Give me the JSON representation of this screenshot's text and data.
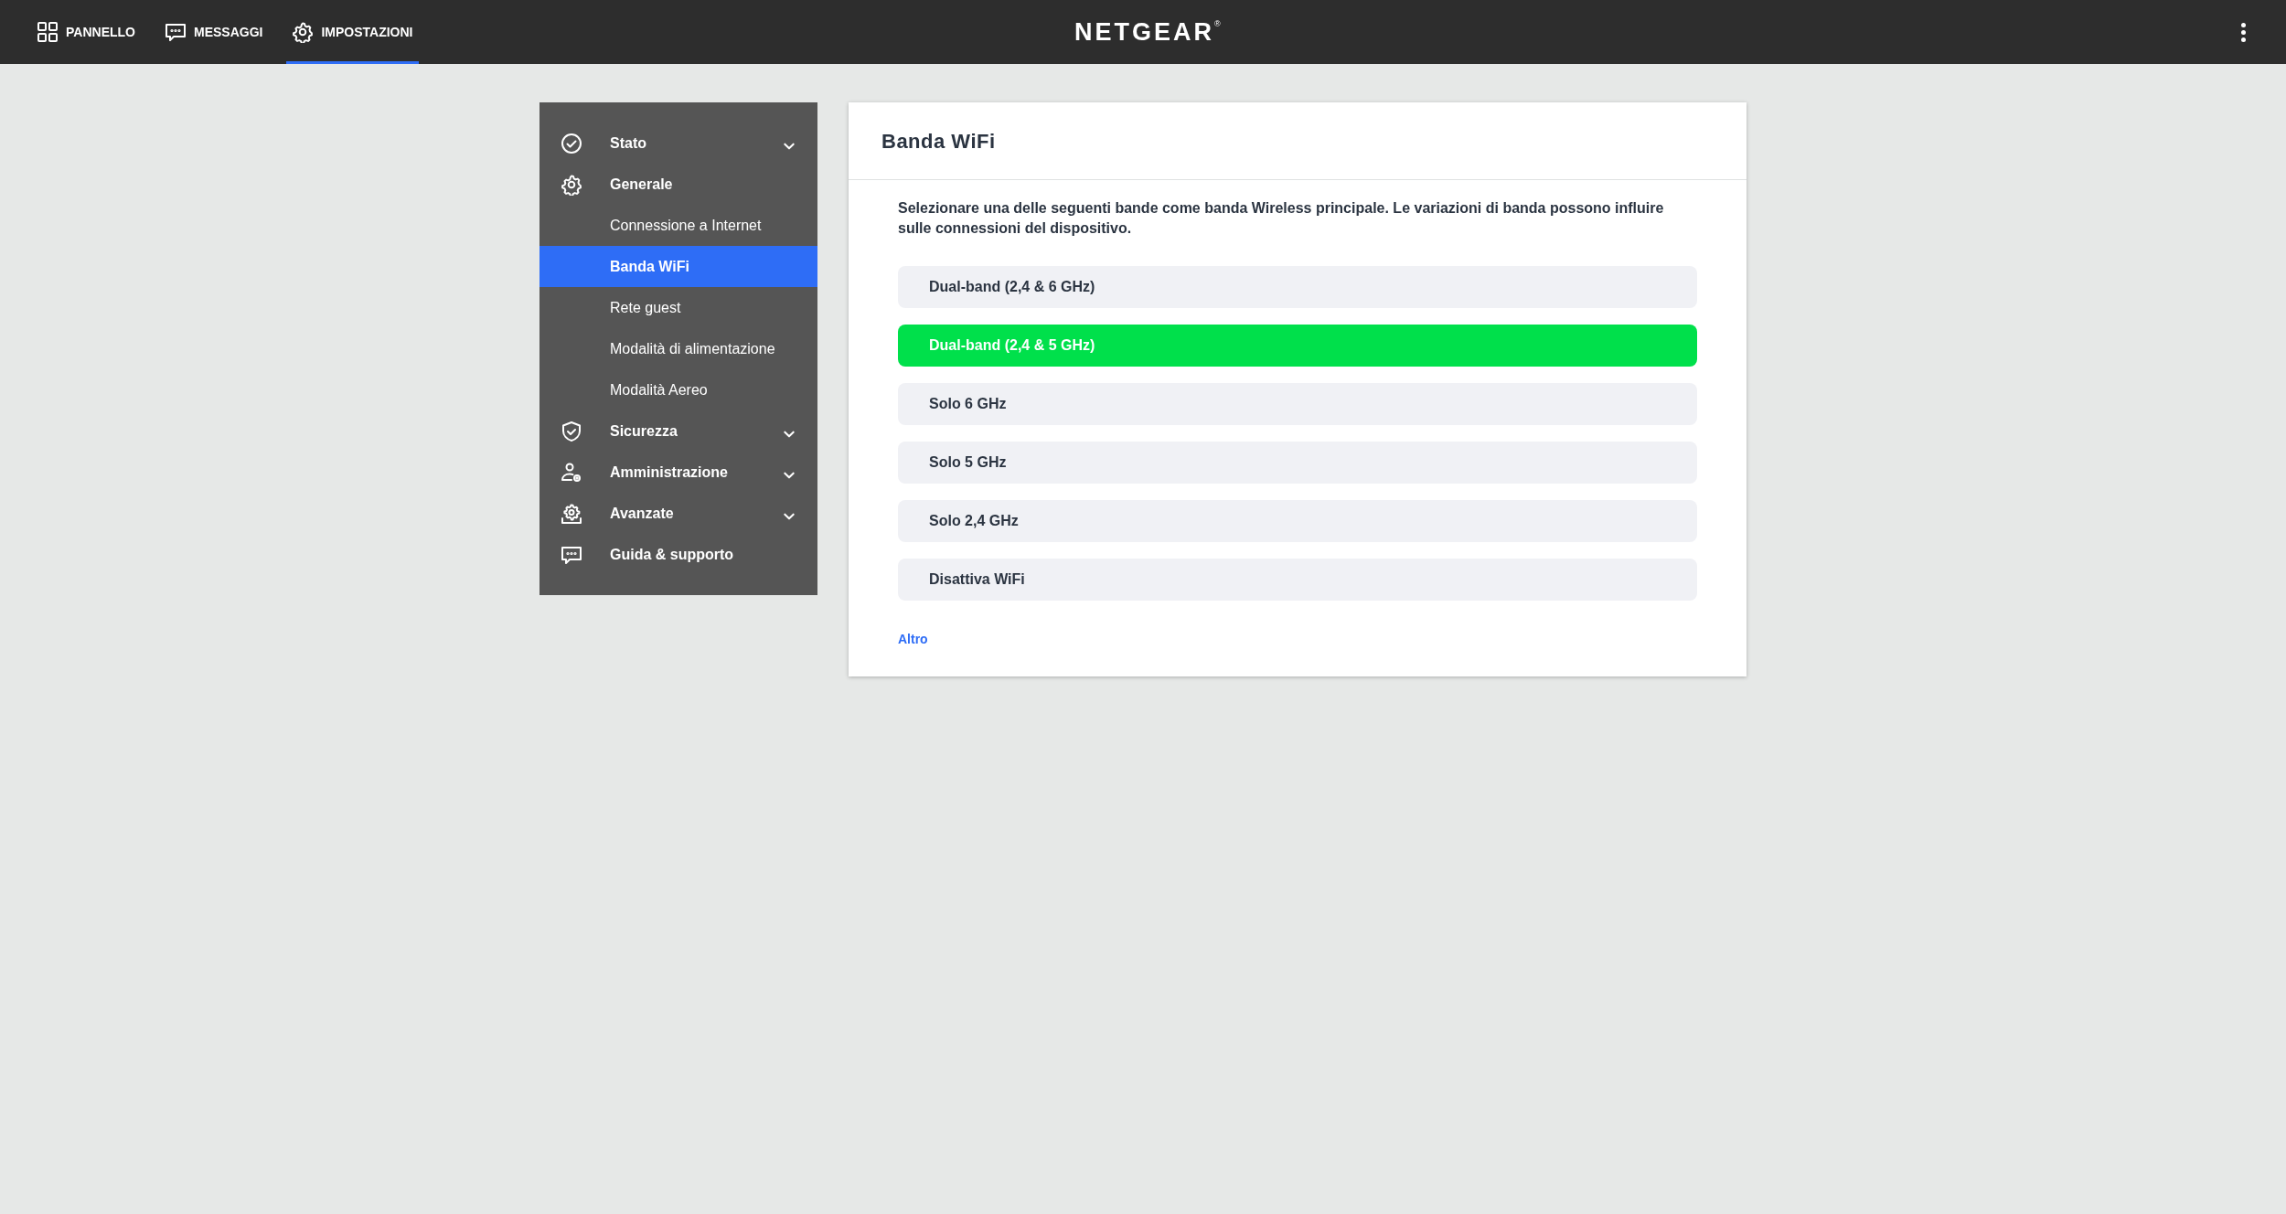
{
  "top_nav": [
    {
      "label": "PANNELLO",
      "selected": false
    },
    {
      "label": "MESSAGGI",
      "selected": false
    },
    {
      "label": "IMPOSTAZIONI",
      "selected": true
    }
  ],
  "brand": "NETGEAR",
  "brand_mark": "®",
  "sidebar": {
    "items": [
      {
        "label": "Stato",
        "expanded": false
      },
      {
        "label": "Generale",
        "expanded": true,
        "children": [
          {
            "label": "Connessione a Internet",
            "selected": false
          },
          {
            "label": "Banda WiFi",
            "selected": true
          },
          {
            "label": "Rete guest",
            "selected": false
          },
          {
            "label": "Modalità di alimentazione",
            "selected": false
          },
          {
            "label": "Modalità Aereo",
            "selected": false
          }
        ]
      },
      {
        "label": "Sicurezza",
        "expanded": false
      },
      {
        "label": "Amministrazione",
        "expanded": false
      },
      {
        "label": "Avanzate",
        "expanded": false
      },
      {
        "label": "Guida & supporto"
      }
    ]
  },
  "panel": {
    "title": "Banda WiFi",
    "description": "Selezionare una delle seguenti bande come banda Wireless principale. Le variazioni di banda possono influire sulle connessioni del dispositivo.",
    "options": [
      {
        "label": "Dual-band (2,4 & 6 GHz)",
        "selected": false
      },
      {
        "label": "Dual-band (2,4 & 5 GHz)",
        "selected": true
      },
      {
        "label": "Solo 6 GHz",
        "selected": false
      },
      {
        "label": "Solo 5 GHz",
        "selected": false
      },
      {
        "label": "Solo 2,4 GHz",
        "selected": false
      },
      {
        "label": "Disattiva WiFi",
        "selected": false
      }
    ],
    "link": "Altro"
  }
}
